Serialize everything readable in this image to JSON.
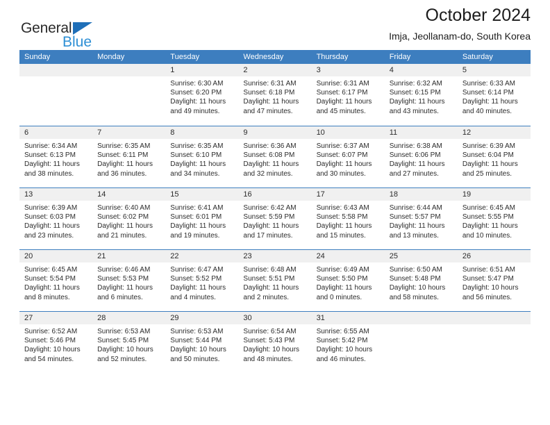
{
  "logo": {
    "name_top": "General",
    "name_bottom": "Blue",
    "triangle_icon": "triangle-icon",
    "color_top": "#2b2b2b",
    "color_bottom": "#2d8fd5",
    "triangle_color": "#1f6fb8"
  },
  "header": {
    "title": "October 2024",
    "subtitle": "Imja, Jeollanam-do, South Korea"
  },
  "colors": {
    "header_blue": "#3d7ebf",
    "day_band_gray": "#f0f0f0",
    "text": "#2b2b2b",
    "white": "#ffffff"
  },
  "weekdays": [
    "Sunday",
    "Monday",
    "Tuesday",
    "Wednesday",
    "Thursday",
    "Friday",
    "Saturday"
  ],
  "weeks": [
    [
      {
        "day": "",
        "empty": true,
        "sunrise": "",
        "sunset": "",
        "daylight_line1": "",
        "daylight_line2": ""
      },
      {
        "day": "",
        "empty": true,
        "sunrise": "",
        "sunset": "",
        "daylight_line1": "",
        "daylight_line2": ""
      },
      {
        "day": "1",
        "empty": false,
        "sunrise": "Sunrise: 6:30 AM",
        "sunset": "Sunset: 6:20 PM",
        "daylight_line1": "Daylight: 11 hours",
        "daylight_line2": "and 49 minutes."
      },
      {
        "day": "2",
        "empty": false,
        "sunrise": "Sunrise: 6:31 AM",
        "sunset": "Sunset: 6:18 PM",
        "daylight_line1": "Daylight: 11 hours",
        "daylight_line2": "and 47 minutes."
      },
      {
        "day": "3",
        "empty": false,
        "sunrise": "Sunrise: 6:31 AM",
        "sunset": "Sunset: 6:17 PM",
        "daylight_line1": "Daylight: 11 hours",
        "daylight_line2": "and 45 minutes."
      },
      {
        "day": "4",
        "empty": false,
        "sunrise": "Sunrise: 6:32 AM",
        "sunset": "Sunset: 6:15 PM",
        "daylight_line1": "Daylight: 11 hours",
        "daylight_line2": "and 43 minutes."
      },
      {
        "day": "5",
        "empty": false,
        "sunrise": "Sunrise: 6:33 AM",
        "sunset": "Sunset: 6:14 PM",
        "daylight_line1": "Daylight: 11 hours",
        "daylight_line2": "and 40 minutes."
      }
    ],
    [
      {
        "day": "6",
        "empty": false,
        "sunrise": "Sunrise: 6:34 AM",
        "sunset": "Sunset: 6:13 PM",
        "daylight_line1": "Daylight: 11 hours",
        "daylight_line2": "and 38 minutes."
      },
      {
        "day": "7",
        "empty": false,
        "sunrise": "Sunrise: 6:35 AM",
        "sunset": "Sunset: 6:11 PM",
        "daylight_line1": "Daylight: 11 hours",
        "daylight_line2": "and 36 minutes."
      },
      {
        "day": "8",
        "empty": false,
        "sunrise": "Sunrise: 6:35 AM",
        "sunset": "Sunset: 6:10 PM",
        "daylight_line1": "Daylight: 11 hours",
        "daylight_line2": "and 34 minutes."
      },
      {
        "day": "9",
        "empty": false,
        "sunrise": "Sunrise: 6:36 AM",
        "sunset": "Sunset: 6:08 PM",
        "daylight_line1": "Daylight: 11 hours",
        "daylight_line2": "and 32 minutes."
      },
      {
        "day": "10",
        "empty": false,
        "sunrise": "Sunrise: 6:37 AM",
        "sunset": "Sunset: 6:07 PM",
        "daylight_line1": "Daylight: 11 hours",
        "daylight_line2": "and 30 minutes."
      },
      {
        "day": "11",
        "empty": false,
        "sunrise": "Sunrise: 6:38 AM",
        "sunset": "Sunset: 6:06 PM",
        "daylight_line1": "Daylight: 11 hours",
        "daylight_line2": "and 27 minutes."
      },
      {
        "day": "12",
        "empty": false,
        "sunrise": "Sunrise: 6:39 AM",
        "sunset": "Sunset: 6:04 PM",
        "daylight_line1": "Daylight: 11 hours",
        "daylight_line2": "and 25 minutes."
      }
    ],
    [
      {
        "day": "13",
        "empty": false,
        "sunrise": "Sunrise: 6:39 AM",
        "sunset": "Sunset: 6:03 PM",
        "daylight_line1": "Daylight: 11 hours",
        "daylight_line2": "and 23 minutes."
      },
      {
        "day": "14",
        "empty": false,
        "sunrise": "Sunrise: 6:40 AM",
        "sunset": "Sunset: 6:02 PM",
        "daylight_line1": "Daylight: 11 hours",
        "daylight_line2": "and 21 minutes."
      },
      {
        "day": "15",
        "empty": false,
        "sunrise": "Sunrise: 6:41 AM",
        "sunset": "Sunset: 6:01 PM",
        "daylight_line1": "Daylight: 11 hours",
        "daylight_line2": "and 19 minutes."
      },
      {
        "day": "16",
        "empty": false,
        "sunrise": "Sunrise: 6:42 AM",
        "sunset": "Sunset: 5:59 PM",
        "daylight_line1": "Daylight: 11 hours",
        "daylight_line2": "and 17 minutes."
      },
      {
        "day": "17",
        "empty": false,
        "sunrise": "Sunrise: 6:43 AM",
        "sunset": "Sunset: 5:58 PM",
        "daylight_line1": "Daylight: 11 hours",
        "daylight_line2": "and 15 minutes."
      },
      {
        "day": "18",
        "empty": false,
        "sunrise": "Sunrise: 6:44 AM",
        "sunset": "Sunset: 5:57 PM",
        "daylight_line1": "Daylight: 11 hours",
        "daylight_line2": "and 13 minutes."
      },
      {
        "day": "19",
        "empty": false,
        "sunrise": "Sunrise: 6:45 AM",
        "sunset": "Sunset: 5:55 PM",
        "daylight_line1": "Daylight: 11 hours",
        "daylight_line2": "and 10 minutes."
      }
    ],
    [
      {
        "day": "20",
        "empty": false,
        "sunrise": "Sunrise: 6:45 AM",
        "sunset": "Sunset: 5:54 PM",
        "daylight_line1": "Daylight: 11 hours",
        "daylight_line2": "and 8 minutes."
      },
      {
        "day": "21",
        "empty": false,
        "sunrise": "Sunrise: 6:46 AM",
        "sunset": "Sunset: 5:53 PM",
        "daylight_line1": "Daylight: 11 hours",
        "daylight_line2": "and 6 minutes."
      },
      {
        "day": "22",
        "empty": false,
        "sunrise": "Sunrise: 6:47 AM",
        "sunset": "Sunset: 5:52 PM",
        "daylight_line1": "Daylight: 11 hours",
        "daylight_line2": "and 4 minutes."
      },
      {
        "day": "23",
        "empty": false,
        "sunrise": "Sunrise: 6:48 AM",
        "sunset": "Sunset: 5:51 PM",
        "daylight_line1": "Daylight: 11 hours",
        "daylight_line2": "and 2 minutes."
      },
      {
        "day": "24",
        "empty": false,
        "sunrise": "Sunrise: 6:49 AM",
        "sunset": "Sunset: 5:50 PM",
        "daylight_line1": "Daylight: 11 hours",
        "daylight_line2": "and 0 minutes."
      },
      {
        "day": "25",
        "empty": false,
        "sunrise": "Sunrise: 6:50 AM",
        "sunset": "Sunset: 5:48 PM",
        "daylight_line1": "Daylight: 10 hours",
        "daylight_line2": "and 58 minutes."
      },
      {
        "day": "26",
        "empty": false,
        "sunrise": "Sunrise: 6:51 AM",
        "sunset": "Sunset: 5:47 PM",
        "daylight_line1": "Daylight: 10 hours",
        "daylight_line2": "and 56 minutes."
      }
    ],
    [
      {
        "day": "27",
        "empty": false,
        "sunrise": "Sunrise: 6:52 AM",
        "sunset": "Sunset: 5:46 PM",
        "daylight_line1": "Daylight: 10 hours",
        "daylight_line2": "and 54 minutes."
      },
      {
        "day": "28",
        "empty": false,
        "sunrise": "Sunrise: 6:53 AM",
        "sunset": "Sunset: 5:45 PM",
        "daylight_line1": "Daylight: 10 hours",
        "daylight_line2": "and 52 minutes."
      },
      {
        "day": "29",
        "empty": false,
        "sunrise": "Sunrise: 6:53 AM",
        "sunset": "Sunset: 5:44 PM",
        "daylight_line1": "Daylight: 10 hours",
        "daylight_line2": "and 50 minutes."
      },
      {
        "day": "30",
        "empty": false,
        "sunrise": "Sunrise: 6:54 AM",
        "sunset": "Sunset: 5:43 PM",
        "daylight_line1": "Daylight: 10 hours",
        "daylight_line2": "and 48 minutes."
      },
      {
        "day": "31",
        "empty": false,
        "sunrise": "Sunrise: 6:55 AM",
        "sunset": "Sunset: 5:42 PM",
        "daylight_line1": "Daylight: 10 hours",
        "daylight_line2": "and 46 minutes."
      },
      {
        "day": "",
        "empty": true,
        "sunrise": "",
        "sunset": "",
        "daylight_line1": "",
        "daylight_line2": ""
      },
      {
        "day": "",
        "empty": true,
        "sunrise": "",
        "sunset": "",
        "daylight_line1": "",
        "daylight_line2": ""
      }
    ]
  ]
}
